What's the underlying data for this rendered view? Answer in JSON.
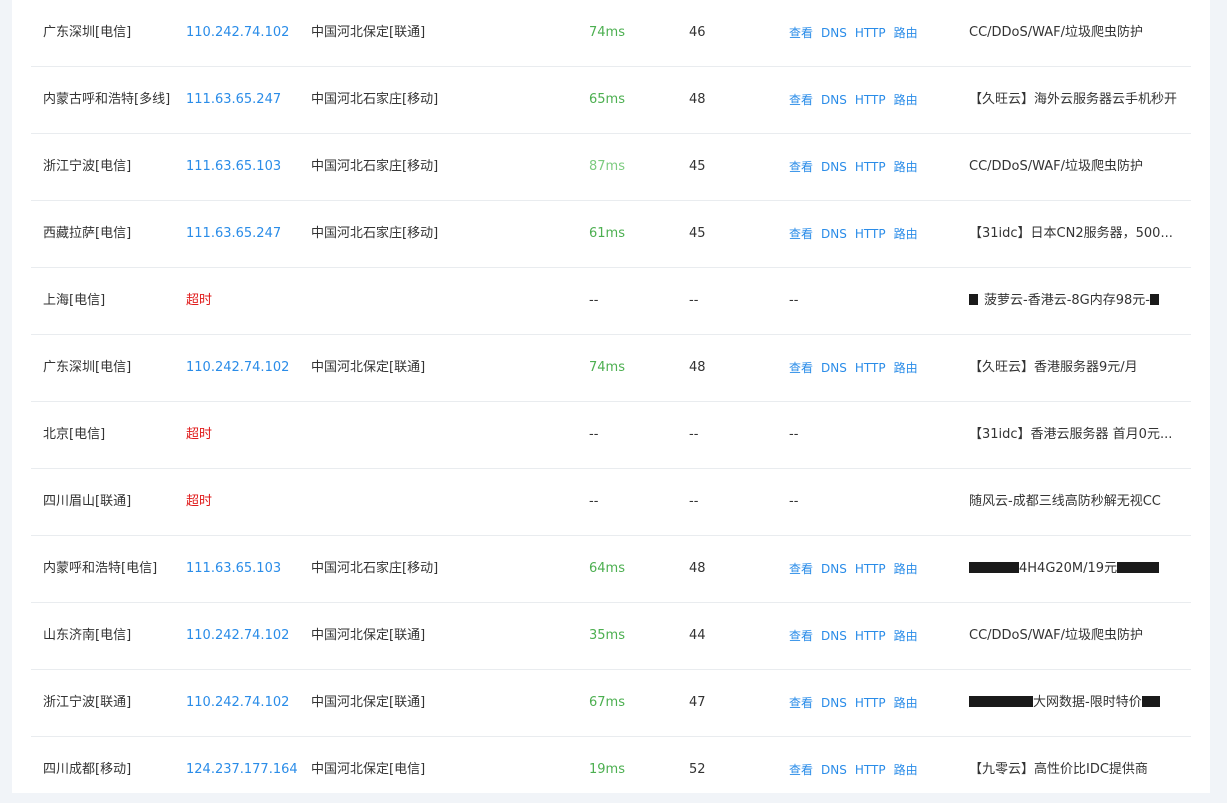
{
  "rows": [
    {
      "loc": "广东深圳[电信]",
      "ip": "110.242.74.102",
      "isp": "中国河北保定[联通]",
      "rt": "74ms",
      "ttl": "46",
      "ops": [
        "查看",
        "DNS",
        "HTTP",
        "路由"
      ],
      "ad": "CC/DDoS/WAF/垃圾爬虫防护"
    },
    {
      "loc": "内蒙古呼和浩特[多线]",
      "ip": "111.63.65.247",
      "isp": "中国河北石家庄[移动]",
      "rt": "65ms",
      "ttl": "48",
      "ops": [
        "查看",
        "DNS",
        "HTTP",
        "路由"
      ],
      "ad": "【久旺云】海外云服务器云手机秒开"
    },
    {
      "loc": "浙江宁波[电信]",
      "ip": "111.63.65.103",
      "isp": "中国河北石家庄[移动]",
      "rt": "87ms",
      "ttl": "45",
      "ops": [
        "查看",
        "DNS",
        "HTTP",
        "路由"
      ],
      "ad": "CC/DDoS/WAF/垃圾爬虫防护"
    },
    {
      "loc": "西藏拉萨[电信]",
      "ip": "111.63.65.247",
      "isp": "中国河北石家庄[移动]",
      "rt": "61ms",
      "ttl": "45",
      "ops": [
        "查看",
        "DNS",
        "HTTP",
        "路由"
      ],
      "ad": "【31idc】日本CN2服务器，500..."
    },
    {
      "loc": "上海[电信]",
      "ip": "超时",
      "isp": "",
      "rt": "--",
      "ttl": "--",
      "ops_dash": "--",
      "ad": "菠萝云-香港云-8G内存98元-"
    },
    {
      "loc": "广东深圳[电信]",
      "ip": "110.242.74.102",
      "isp": "中国河北保定[联通]",
      "rt": "74ms",
      "ttl": "48",
      "ops": [
        "查看",
        "DNS",
        "HTTP",
        "路由"
      ],
      "ad": "【久旺云】香港服务器9元/月"
    },
    {
      "loc": "北京[电信]",
      "ip": "超时",
      "isp": "",
      "rt": "--",
      "ttl": "--",
      "ops_dash": "--",
      "ad": "【31idc】香港云服务器 首月0元..."
    },
    {
      "loc": "四川眉山[联通]",
      "ip": "超时",
      "isp": "",
      "rt": "--",
      "ttl": "--",
      "ops_dash": "--",
      "ad": "随风云-成都三线高防秒解无视CC"
    },
    {
      "loc": "内蒙呼和浩特[电信]",
      "ip": "111.63.65.103",
      "isp": "中国河北石家庄[移动]",
      "rt": "64ms",
      "ttl": "48",
      "ops": [
        "查看",
        "DNS",
        "HTTP",
        "路由"
      ],
      "ad": "4H4G20M/19元"
    },
    {
      "loc": "山东济南[电信]",
      "ip": "110.242.74.102",
      "isp": "中国河北保定[联通]",
      "rt": "35ms",
      "ttl": "44",
      "ops": [
        "查看",
        "DNS",
        "HTTP",
        "路由"
      ],
      "ad": "CC/DDoS/WAF/垃圾爬虫防护"
    },
    {
      "loc": "浙江宁波[联通]",
      "ip": "110.242.74.102",
      "isp": "中国河北保定[联通]",
      "rt": "67ms",
      "ttl": "47",
      "ops": [
        "查看",
        "DNS",
        "HTTP",
        "路由"
      ],
      "ad": "大网数据-限时特价"
    },
    {
      "loc": "四川成都[移动]",
      "ip": "124.237.177.164",
      "isp": "中国河北保定[电信]",
      "rt": "19ms",
      "ttl": "52",
      "ops": [
        "查看",
        "DNS",
        "HTTP",
        "路由"
      ],
      "ad": "【九零云】高性价比IDC提供商"
    }
  ]
}
